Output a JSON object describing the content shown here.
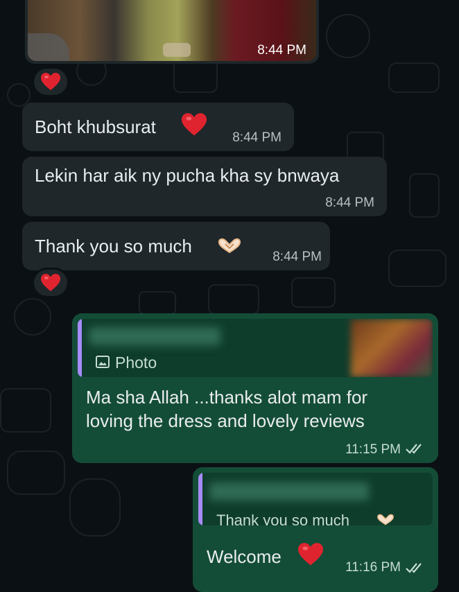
{
  "messages": [
    {
      "text": "Boht khubsurat",
      "time": "8:44 PM"
    },
    {
      "text": "Lekin har aik ny pucha kha sy bnwaya",
      "time": "8:44 PM"
    },
    {
      "text": "Thank you so much",
      "time": "8:44 PM"
    }
  ],
  "photo_time": "8:44 PM",
  "reply1": {
    "quote_label": "Photo",
    "text_line1": "Ma sha Allah ...thanks alot mam for",
    "text_line2": "loving the dress and lovely reviews",
    "time": "11:15 PM"
  },
  "reply2": {
    "quote_text": "Thank you so much",
    "text": "Welcome",
    "time": "11:16 PM"
  },
  "icons": {
    "heart": "red-heart-icon",
    "hands": "heart-hands-icon",
    "photo": "photo-icon",
    "ticks": "double-check-icon"
  },
  "colors": {
    "background": "#0b1014",
    "incoming_bubble": "#1f272a",
    "outgoing_bubble": "#144d37",
    "accent_heart": "#e0242f",
    "read_ticks": "#c5ddd3",
    "quote_bar": "#a78bfa"
  }
}
